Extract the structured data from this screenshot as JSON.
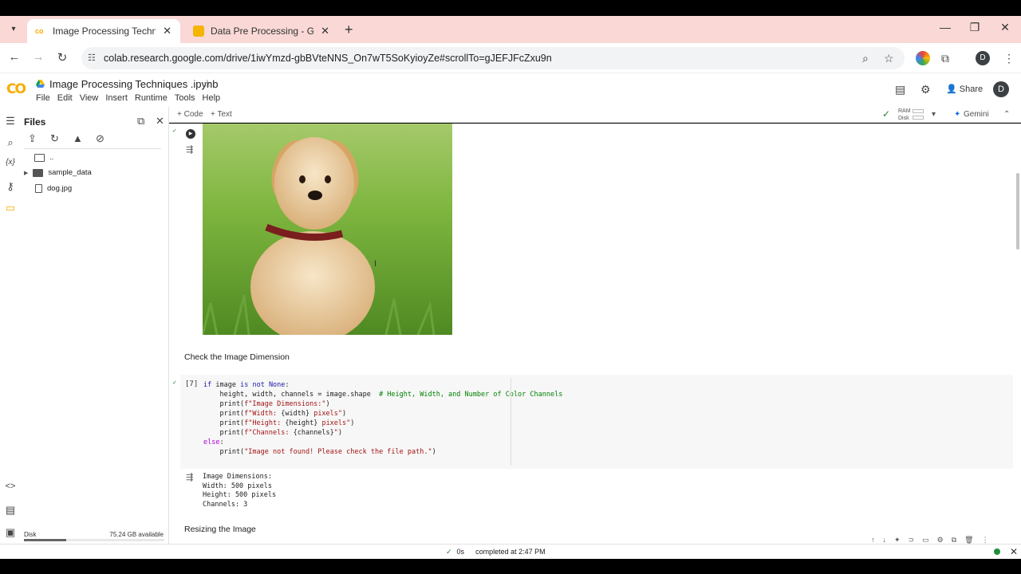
{
  "browser": {
    "tabs": [
      {
        "title": "Image Processing Techniques .ipynb - Colab",
        "active": true
      },
      {
        "title": "Data Pre Processing - Google Sheets",
        "active": false
      }
    ],
    "url": "colab.research.google.com/drive/1iwYmzd-gbBVteNNS_On7wT5SoKyioyZe#scrollTo=gJEFJFcZxu9n",
    "profile_initial": "D"
  },
  "colab": {
    "logo": "CO",
    "notebook_title": "Image Processing Techniques .ipynb",
    "menu": [
      "File",
      "Edit",
      "View",
      "Insert",
      "Runtime",
      "Tools",
      "Help"
    ],
    "share_label": "Share",
    "user_initial": "D",
    "toolbar": {
      "add_code": "+ Code",
      "add_text": "+ Text",
      "ram_label": "RAM",
      "disk_label": "Disk",
      "gemini": "Gemini"
    }
  },
  "files_panel": {
    "title": "Files",
    "tree": [
      {
        "name": "..",
        "type": "folder-open"
      },
      {
        "name": "sample_data",
        "type": "folder"
      },
      {
        "name": "dog.jpg",
        "type": "file"
      }
    ],
    "disk_label": "Disk",
    "disk_available": "75.24 GB available",
    "disk_used_fraction": 0.3
  },
  "notebook": {
    "text_cell_1": "Check the Image Dimension",
    "code_exec_count": "[7]",
    "code_lines": [
      "if image is not None:",
      "    height, width, channels = image.shape  # Height, Width, and Number of Color Channels",
      "    print(f\"Image Dimensions:\")",
      "    print(f\"Width: {width} pixels\")",
      "    print(f\"Height: {height} pixels\")",
      "    print(f\"Channels: {channels}\")",
      "else:",
      "    print(\"Image not found! Please check the file path.\")"
    ],
    "output_lines": [
      "Image Dimensions:",
      "Width: 500 pixels",
      "Height: 500 pixels",
      "Channels: 3"
    ],
    "text_cell_2": "Resizing the Image"
  },
  "status": {
    "check": "✓",
    "duration": "0s",
    "message": "completed at 2:47 PM"
  },
  "colors": {
    "tab_strip": "#f9d8d6",
    "colab_orange": "#f9ab00",
    "status_green": "#1e8e3e"
  }
}
